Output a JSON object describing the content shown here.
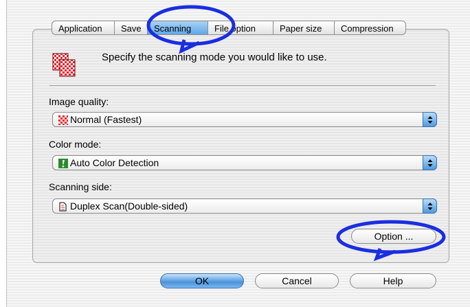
{
  "tabs": [
    {
      "label": "Application",
      "selected": false
    },
    {
      "label": "Save",
      "selected": false
    },
    {
      "label": "Scanning",
      "selected": true
    },
    {
      "label": "File option",
      "selected": false
    },
    {
      "label": "Paper size",
      "selected": false
    },
    {
      "label": "Compression",
      "selected": false
    }
  ],
  "header": {
    "description": "Specify the scanning mode you would like to use."
  },
  "image_quality": {
    "label": "Image quality:",
    "value": "Normal  (Fastest)",
    "icon": "checker-pattern-icon"
  },
  "color_mode": {
    "label": "Color mode:",
    "value": "Auto Color Detection",
    "icon": "exclamation-green-icon"
  },
  "scanning_side": {
    "label": "Scanning side:",
    "value": "Duplex Scan(Double-sided)",
    "icon": "duplex-page-icon"
  },
  "buttons": {
    "option": "Option ...",
    "ok": "OK",
    "cancel": "Cancel",
    "help": "Help"
  },
  "colors": {
    "accent": "#1a2ee0",
    "selected_tab": "#5fa7e8",
    "checker_red": "#e8202a"
  }
}
